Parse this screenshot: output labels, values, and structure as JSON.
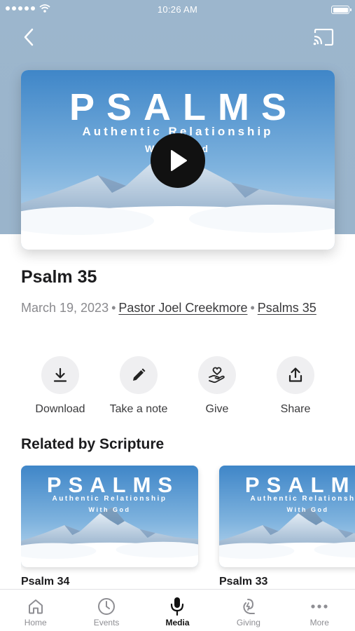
{
  "status_bar": {
    "time": "10:26 AM"
  },
  "hero": {
    "thumb_title": "PSALMS",
    "thumb_subtitle": "Authentic Relationship",
    "thumb_subtitle2": "With God"
  },
  "sermon": {
    "title": "Psalm 35",
    "date": "March 19, 2023",
    "separator": "•",
    "speaker": "Pastor Joel Creekmore",
    "series": "Psalms 35"
  },
  "actions": [
    {
      "label": "Download",
      "icon": "download-icon"
    },
    {
      "label": "Take a note",
      "icon": "pencil-icon"
    },
    {
      "label": "Give",
      "icon": "heart-hand-icon"
    },
    {
      "label": "Share",
      "icon": "share-icon"
    }
  ],
  "related": {
    "title": "Related by Scripture",
    "items": [
      {
        "label": "Psalm 34",
        "thumb_title": "PSALMS",
        "thumb_subtitle": "Authentic Relationship",
        "thumb_subtitle2": "With God"
      },
      {
        "label": "Psalm 33",
        "thumb_title": "PSALMS",
        "thumb_subtitle": "Authentic Relationship",
        "thumb_subtitle2": "With God"
      }
    ]
  },
  "tabs": [
    {
      "label": "Home",
      "icon": "home-icon",
      "active": false
    },
    {
      "label": "Events",
      "icon": "clock-icon",
      "active": false
    },
    {
      "label": "Media",
      "icon": "microphone-icon",
      "active": true
    },
    {
      "label": "Giving",
      "icon": "giving-icon",
      "active": false
    },
    {
      "label": "More",
      "icon": "more-icon",
      "active": false
    }
  ],
  "colors": {
    "header_bg": "#9cb6cd",
    "active_tab": "#111111",
    "inactive_tab": "#8e8e93"
  }
}
